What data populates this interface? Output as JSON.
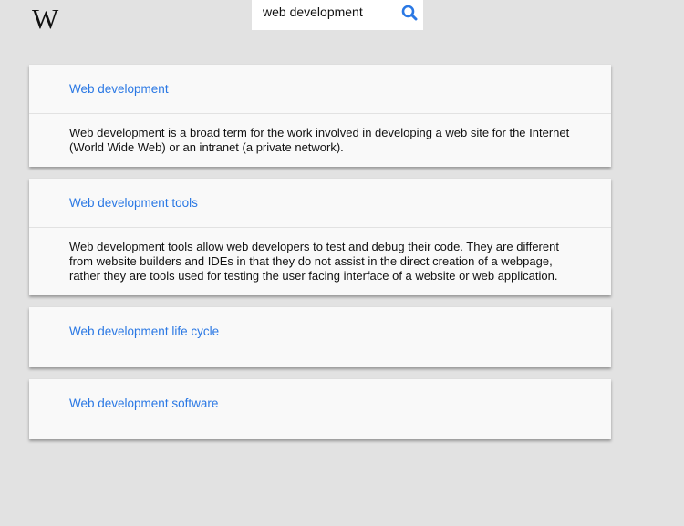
{
  "logo": {
    "text": "W"
  },
  "search": {
    "value": "web development",
    "icon": "search-icon"
  },
  "results": [
    {
      "title": "Web development",
      "snippet": "Web development is a broad term for the work involved in developing a web site for the Internet (World Wide Web) or an intranet (a private network)."
    },
    {
      "title": "Web development tools",
      "snippet": "Web development tools allow web developers to test and debug their code. They are different from website builders and IDEs in that they do not assist in the direct creation of a webpage, rather they are tools used for testing the user facing interface of a website or web application."
    },
    {
      "title": "Web development life cycle",
      "snippet": ""
    },
    {
      "title": "Web development software",
      "snippet": ""
    }
  ],
  "colors": {
    "background": "#e2e2e2",
    "card": "#f9f9f9",
    "link": "#2a78e4",
    "search_icon": "#2a78e4"
  }
}
